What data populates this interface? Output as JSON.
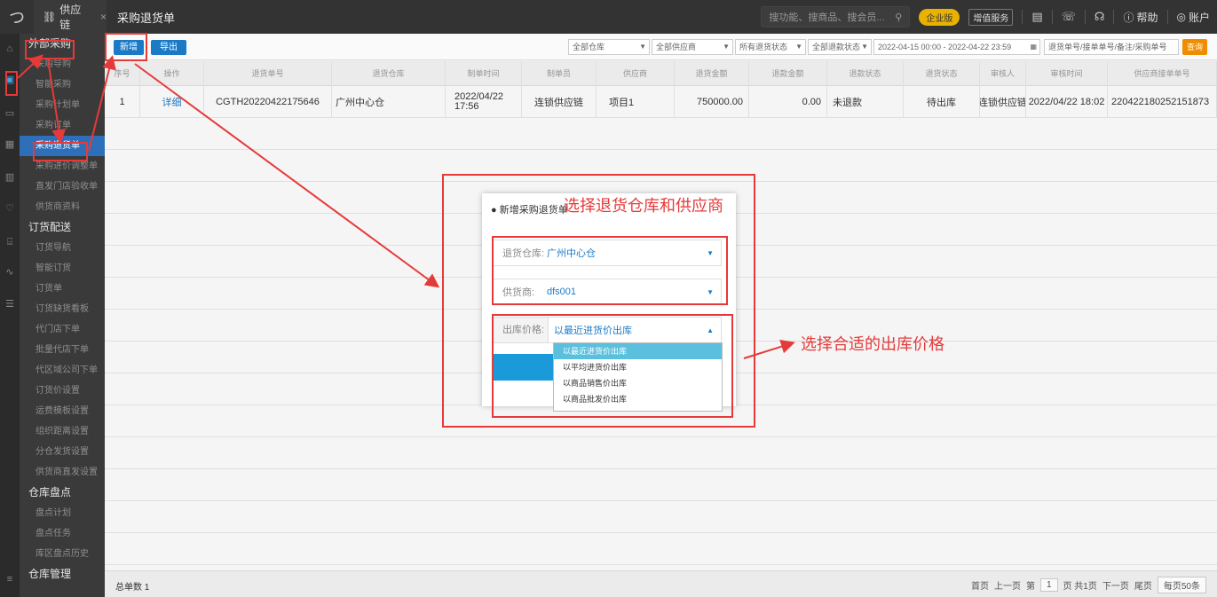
{
  "topbar": {
    "app_tab": "供应链",
    "app_tab_close": "×",
    "page_title": "采购退货单",
    "search_placeholder": "搜功能、搜商品、搜会员...",
    "enterprise_badge": "企业版",
    "vas_badge": "增值服务",
    "help": "帮助",
    "account": "账户"
  },
  "sidebar": {
    "groups": [
      {
        "label": "外部采购",
        "items": [
          "采购导购",
          "智能采购",
          "采购计划单",
          "采购订单",
          "采购退货单",
          "采购进价调整单",
          "直发门店验收单",
          "供货商资料"
        ]
      },
      {
        "label": "订货配送",
        "items": [
          "订货导航",
          "智能订货",
          "订货单",
          "订货缺货看板",
          "代门店下单",
          "批量代店下单",
          "代区域公司下单",
          "订货价设置",
          "运费模板设置",
          "组织距离设置",
          "分仓发货设置",
          "供货商直发设置"
        ]
      },
      {
        "label": "仓库盘点",
        "items": [
          "盘点计划",
          "盘点任务",
          "库区盘点历史"
        ]
      },
      {
        "label": "仓库管理",
        "items": []
      }
    ],
    "active_item": "采购退货单"
  },
  "toolbar": {
    "new_label": "新增",
    "export_label": "导出",
    "filters": [
      "全部仓库",
      "全部供应商",
      "所有退货状态",
      "全部退款状态",
      "2022-04-15 00:00  -  2022-04-22 23:59",
      "退货单号/接单单号/备注/采购单号"
    ],
    "query_label": "查询"
  },
  "table": {
    "columns": [
      "序号",
      "操作",
      "退货单号",
      "退货仓库",
      "制单时间",
      "制单员",
      "供应商",
      "退货金额",
      "退款金额",
      "退款状态",
      "退货状态",
      "审核人",
      "审核时间",
      "供应商接单单号"
    ],
    "rows": [
      [
        "1",
        "详细",
        "CGTH20220422175646",
        "广州中心仓",
        "2022/04/22 17:56",
        "连锁供应链",
        "项目1",
        "750000.00",
        "0.00",
        "未退款",
        "待出库",
        "连锁供应链",
        "2022/04/22 18:02",
        "220422180252151873"
      ]
    ]
  },
  "footer": {
    "total": "总单数 1",
    "first": "首页",
    "prev": "上一页",
    "page_prefix": "第",
    "page_num": "1",
    "page_suffix": "页 共1页",
    "next": "下一页",
    "last": "尾页",
    "per_page": "每页50条"
  },
  "modal": {
    "title": "● 新增采购退货单",
    "warehouse_label": "退货仓库:",
    "warehouse_value": "广州中心仓",
    "supplier_label": "供货商:",
    "supplier_value": "dfs001",
    "price_label": "出库价格:",
    "price_value": "以最近进货价出库",
    "price_options": [
      "以最近进货价出库",
      "以平均进货价出库",
      "以商品销售价出库",
      "以商品批发价出库"
    ]
  },
  "annotations": {
    "note_top": "选择退货仓库和供应商",
    "note_right": "选择合适的出库价格"
  },
  "colors": {
    "accent": "#1a7ac6",
    "annotation": "#e53a3a",
    "query": "#f08c00"
  }
}
